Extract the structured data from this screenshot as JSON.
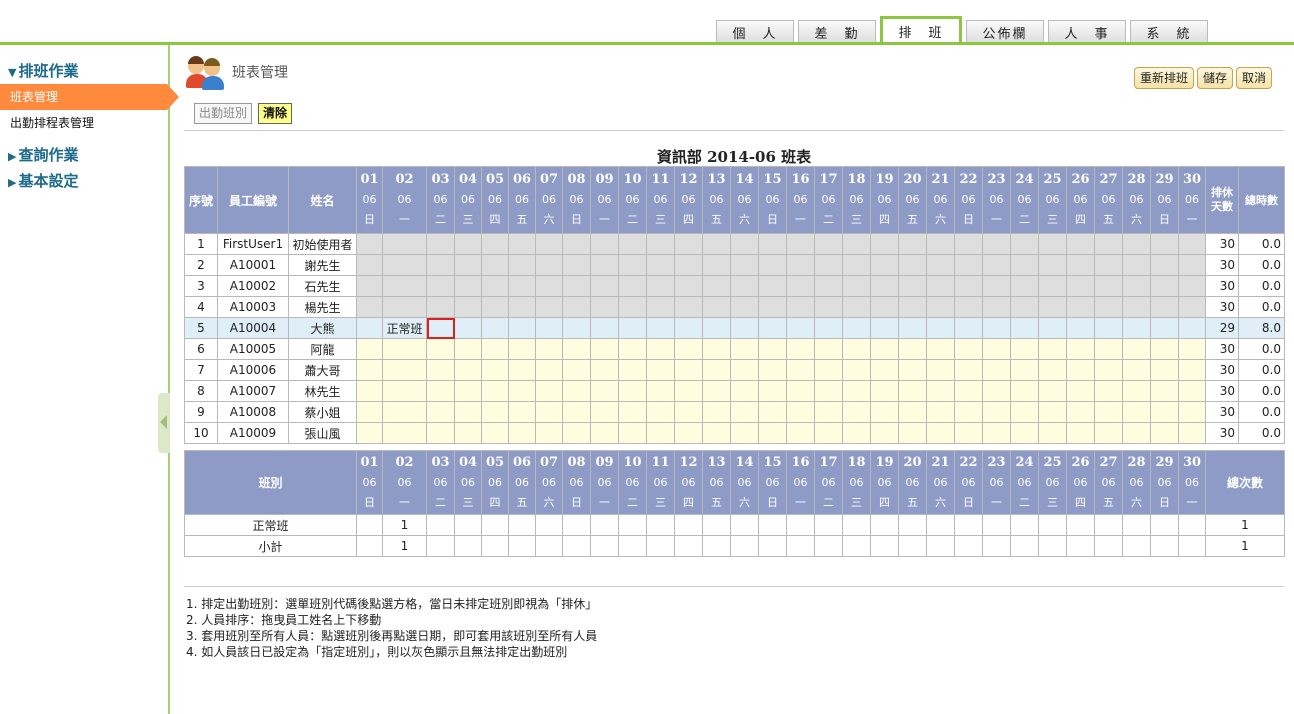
{
  "top_tabs": [
    {
      "label": "個　人",
      "active": false
    },
    {
      "label": "差　勤",
      "active": false
    },
    {
      "label": "排　班",
      "active": true
    },
    {
      "label": "公佈欄",
      "active": false
    },
    {
      "label": "人　事",
      "active": false
    },
    {
      "label": "系　統",
      "active": false
    }
  ],
  "sidebar": {
    "sections": [
      {
        "label": "排班作業",
        "expanded": true,
        "items": [
          {
            "label": "班表管理",
            "active": true
          },
          {
            "label": "出勤排程表管理",
            "active": false
          }
        ]
      },
      {
        "label": "查詢作業",
        "expanded": false,
        "items": []
      },
      {
        "label": "基本設定",
        "expanded": false,
        "items": []
      }
    ]
  },
  "page": {
    "title": "班表管理",
    "actions": [
      "重新排班",
      "儲存",
      "取消"
    ],
    "shift_buttons": [
      {
        "label": "出勤班別",
        "highlight": false
      },
      {
        "label": "清除",
        "highlight": true
      }
    ],
    "schedule_title": "資訊部 2014-06 班表"
  },
  "schedule": {
    "headers": {
      "seq": "序號",
      "emp_id": "員工編號",
      "name": "姓名",
      "rest_days": "排休天數",
      "total_hours": "總時數"
    },
    "month": "06",
    "days": [
      "01",
      "02",
      "03",
      "04",
      "05",
      "06",
      "07",
      "08",
      "09",
      "10",
      "11",
      "12",
      "13",
      "14",
      "15",
      "16",
      "17",
      "18",
      "19",
      "20",
      "21",
      "22",
      "23",
      "24",
      "25",
      "26",
      "27",
      "28",
      "29",
      "30"
    ],
    "weekdays": [
      "日",
      "一",
      "二",
      "三",
      "四",
      "五",
      "六",
      "日",
      "一",
      "二",
      "三",
      "四",
      "五",
      "六",
      "日",
      "一",
      "二",
      "三",
      "四",
      "五",
      "六",
      "日",
      "一",
      "二",
      "三",
      "四",
      "五",
      "六",
      "日",
      "一"
    ],
    "rows": [
      {
        "seq": "1",
        "emp_id": "FirstUser1",
        "name": "初始使用者",
        "state": "gray",
        "shifts": {},
        "rest": "30",
        "hours": "0.0"
      },
      {
        "seq": "2",
        "emp_id": "A10001",
        "name": "謝先生",
        "state": "gray",
        "shifts": {},
        "rest": "30",
        "hours": "0.0"
      },
      {
        "seq": "3",
        "emp_id": "A10002",
        "name": "石先生",
        "state": "gray",
        "shifts": {},
        "rest": "30",
        "hours": "0.0"
      },
      {
        "seq": "4",
        "emp_id": "A10003",
        "name": "楊先生",
        "state": "gray",
        "shifts": {},
        "rest": "30",
        "hours": "0.0"
      },
      {
        "seq": "5",
        "emp_id": "A10004",
        "name": "大熊",
        "state": "blue",
        "shifts": {
          "02": "正常班"
        },
        "rest": "29",
        "hours": "8.0"
      },
      {
        "seq": "6",
        "emp_id": "A10005",
        "name": "阿龍",
        "state": "yel",
        "shifts": {},
        "rest": "30",
        "hours": "0.0"
      },
      {
        "seq": "7",
        "emp_id": "A10006",
        "name": "蕭大哥",
        "state": "yel",
        "shifts": {},
        "rest": "30",
        "hours": "0.0"
      },
      {
        "seq": "8",
        "emp_id": "A10007",
        "name": "林先生",
        "state": "yel",
        "shifts": {},
        "rest": "30",
        "hours": "0.0"
      },
      {
        "seq": "9",
        "emp_id": "A10008",
        "name": "蔡小姐",
        "state": "yel",
        "shifts": {},
        "rest": "30",
        "hours": "0.0"
      },
      {
        "seq": "10",
        "emp_id": "A10009",
        "name": "張山風",
        "state": "yel",
        "shifts": {},
        "rest": "30",
        "hours": "0.0"
      }
    ],
    "selected_cell": {
      "row": "5",
      "day": "03"
    }
  },
  "summary": {
    "headers": {
      "shift": "班別",
      "total": "總次數"
    },
    "rows": [
      {
        "label": "正常班",
        "counts": {
          "02": "1"
        },
        "total": "1"
      },
      {
        "label": "小計",
        "counts": {
          "02": "1"
        },
        "total": "1"
      }
    ]
  },
  "notes": [
    "1. 排定出勤班別：選單班別代碼後點選方格，當日未排定班別即視為「排休」",
    "2. 人員排序：拖曳員工姓名上下移動",
    "3. 套用班別至所有人員：點選班別後再點選日期，即可套用該班別至所有人員",
    "4. 如人員該日已設定為「指定班別」，則以灰色顯示且無法排定出勤班別"
  ],
  "colors": {
    "accent": "#8dc63f",
    "active_item": "#ff8a3d",
    "header_bg": "#8e9bc7",
    "gray_cell": "#dedede",
    "yellow_cell": "#fffde0",
    "blue_row": "#dfeef7",
    "selection": "#e02020"
  }
}
